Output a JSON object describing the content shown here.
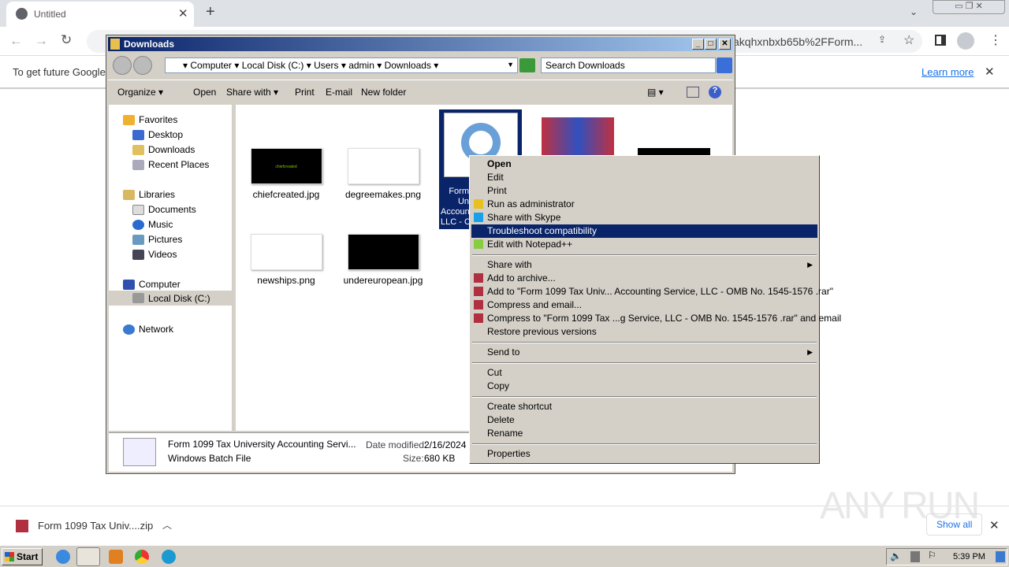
{
  "browser": {
    "tab_title": "Untitled",
    "url_fragment": "akqhxnbxb65b%2FForm...",
    "infobar_text": "To get future Google",
    "learn_more": "Learn more"
  },
  "explorer": {
    "title": "Downloads",
    "breadcrumb": [
      "Computer",
      "Local Disk (C:)",
      "Users",
      "admin",
      "Downloads"
    ],
    "search_placeholder": "Search Downloads",
    "toolbar": {
      "organize": "Organize",
      "open": "Open",
      "share_with": "Share with",
      "print": "Print",
      "email": "E-mail",
      "new_folder": "New folder"
    },
    "nav": {
      "favorites": "Favorites",
      "desktop": "Desktop",
      "downloads": "Downloads",
      "recent": "Recent Places",
      "libraries": "Libraries",
      "documents": "Documents",
      "music": "Music",
      "pictures": "Pictures",
      "videos": "Videos",
      "computer": "Computer",
      "local_disk": "Local Disk (C:)",
      "network": "Network"
    },
    "files": [
      {
        "name": "chiefcreated.jpg",
        "thumb_text": "chiefcreated"
      },
      {
        "name": "degreemakes.png"
      },
      {
        "name": "Form 1099 Tax University Accounting Service, LLC - OMB No. 1545-1576",
        "label_visible": "Form\nUn\nAccoun\nLLC - C"
      },
      {
        "name": "newships.png"
      },
      {
        "name": "undereuropean.jpg"
      }
    ],
    "details": {
      "name": "Form 1099 Tax University Accounting Servi...",
      "modified_label": "Date modified:",
      "modified": "2/16/2024 3",
      "type": "Windows Batch File",
      "size_label": "Size:",
      "size": "680 KB"
    }
  },
  "context_menu": [
    {
      "label": "Open",
      "bold": true
    },
    {
      "label": "Edit"
    },
    {
      "label": "Print"
    },
    {
      "label": "Run as administrator",
      "icon": "shield-icon"
    },
    {
      "label": "Share with Skype",
      "icon": "skype-icon"
    },
    {
      "label": "Troubleshoot compatibility",
      "highlighted": true
    },
    {
      "label": "Edit with Notepad++",
      "icon": "notepadpp-icon"
    },
    {
      "sep": true
    },
    {
      "label": "Share with",
      "submenu": true
    },
    {
      "label": "Add to archive...",
      "icon": "winrar-icon"
    },
    {
      "label": "Add to \"Form 1099 Tax Univ... Accounting Service, LLC - OMB No. 1545-1576 .rar\"",
      "icon": "winrar-icon"
    },
    {
      "label": "Compress and email...",
      "icon": "winrar-icon"
    },
    {
      "label": "Compress to \"Form 1099 Tax ...g Service, LLC - OMB No. 1545-1576 .rar\" and email",
      "icon": "winrar-icon"
    },
    {
      "label": "Restore previous versions"
    },
    {
      "sep": true
    },
    {
      "label": "Send to",
      "submenu": true
    },
    {
      "sep": true
    },
    {
      "label": "Cut"
    },
    {
      "label": "Copy"
    },
    {
      "sep": true
    },
    {
      "label": "Create shortcut"
    },
    {
      "label": "Delete"
    },
    {
      "label": "Rename"
    },
    {
      "sep": true
    },
    {
      "label": "Properties"
    }
  ],
  "downloads": {
    "file": "Form 1099 Tax Univ....zip",
    "show_all": "Show all"
  },
  "taskbar": {
    "start": "Start",
    "clock": "5:39 PM"
  },
  "watermark": "ANY RUN"
}
